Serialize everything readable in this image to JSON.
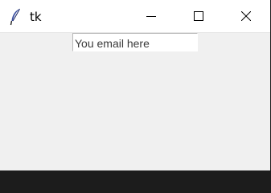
{
  "window": {
    "title": "tk",
    "app_icon": "feather-icon",
    "controls": {
      "minimize_icon": "minimize-icon",
      "maximize_icon": "maximize-icon",
      "close_icon": "close-icon"
    }
  },
  "form": {
    "email": {
      "value": "You email here"
    }
  }
}
